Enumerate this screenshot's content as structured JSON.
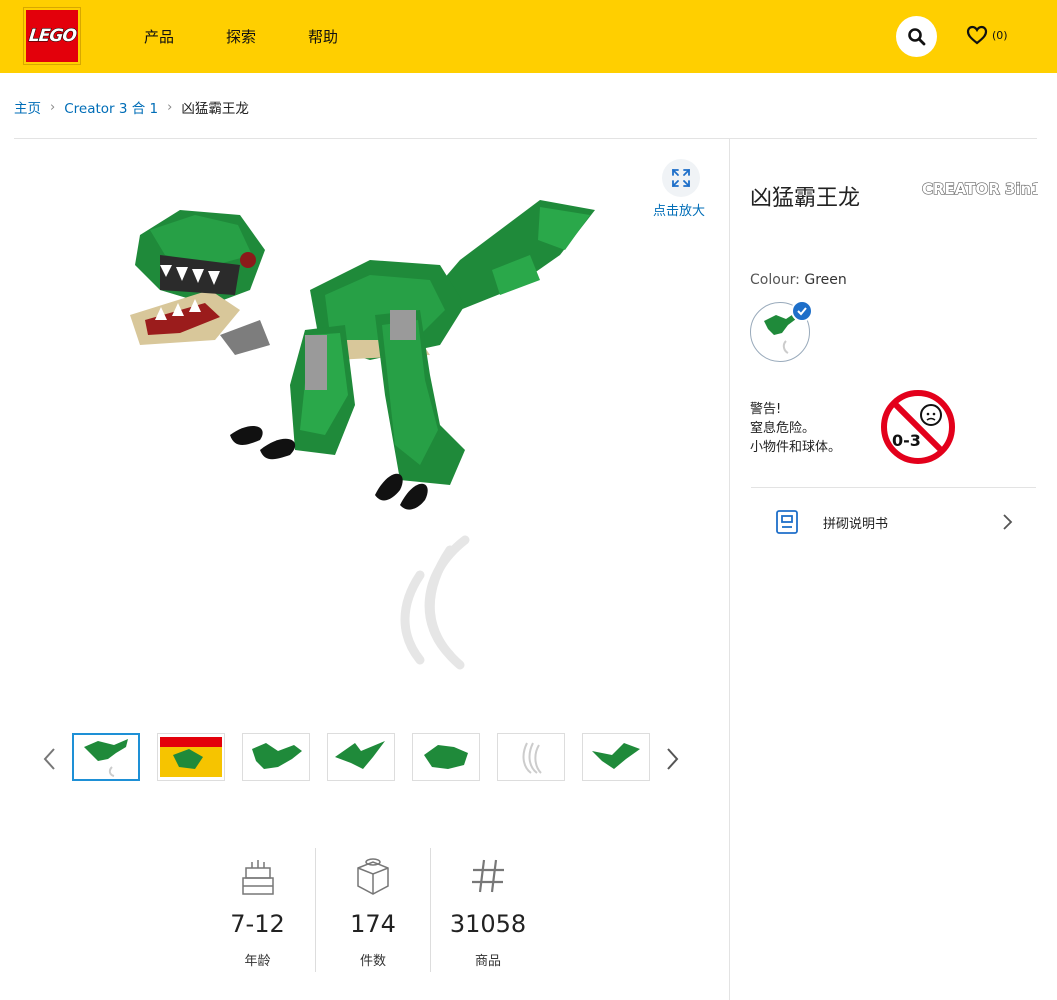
{
  "header": {
    "logo_text": "LEGO",
    "nav": [
      "产品",
      "探索",
      "帮助"
    ],
    "wishlist_count": "(0)",
    "brand_color": "#ffcf00",
    "logo_color": "#e3000b"
  },
  "breadcrumb": {
    "home": "主页",
    "category": "Creator 3 合 1",
    "current": "凶猛霸王龙"
  },
  "gallery": {
    "zoom_label": "点击放大",
    "thumb_count": 7,
    "active_thumb": 0
  },
  "stats": [
    {
      "icon": "cake-icon",
      "value": "7-12",
      "label": "年龄"
    },
    {
      "icon": "brick-icon",
      "value": "174",
      "label": "件数"
    },
    {
      "icon": "hash-icon",
      "value": "31058",
      "label": "商品"
    }
  ],
  "product": {
    "title": "凶猛霸王龙",
    "theme_logo": "CREATOR 3in1",
    "colour_label": "Colour:",
    "colour_value": "Green",
    "warning_lines": [
      "警告!",
      "窒息危险。",
      "小物件和球体。"
    ],
    "age_warning": "0-3",
    "manual_label": "拼砌说明书"
  }
}
